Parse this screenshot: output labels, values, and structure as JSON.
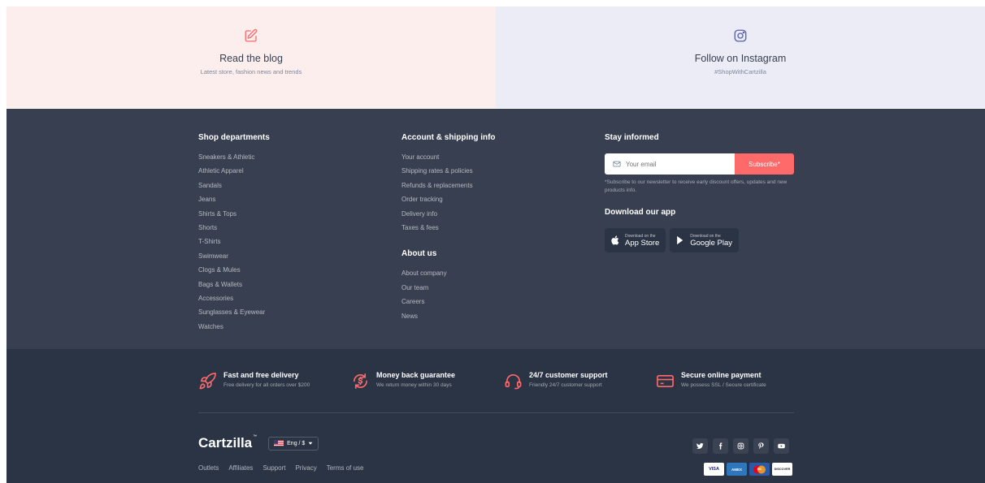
{
  "promo": {
    "blog": {
      "icon": "edit-icon",
      "title": "Read the blog",
      "subtitle": "Latest store, fashion news and trends"
    },
    "instagram": {
      "icon": "instagram-icon",
      "title": "Follow on Instagram",
      "subtitle": "#ShopWithCartzilla"
    }
  },
  "footer": {
    "departments": {
      "title": "Shop departments",
      "links": [
        "Sneakers & Athletic",
        "Athletic Apparel",
        "Sandals",
        "Jeans",
        "Shirts & Tops",
        "Shorts",
        "T-Shirts",
        "Swimwear",
        "Clogs & Mules",
        "Bags & Wallets",
        "Accessories",
        "Sunglasses & Eyewear",
        "Watches"
      ]
    },
    "account": {
      "title": "Account & shipping info",
      "links": [
        "Your account",
        "Shipping rates & policies",
        "Refunds & replacements",
        "Order tracking",
        "Delivery info",
        "Taxes & fees"
      ]
    },
    "about": {
      "title": "About us",
      "links": [
        "About company",
        "Our team",
        "Careers",
        "News"
      ]
    },
    "newsletter": {
      "title": "Stay informed",
      "placeholder": "Your email",
      "button": "Subscribe*",
      "note": "*Subscribe to our newsletter to receive early discount offers, updates and new products info."
    },
    "app": {
      "title": "Download our app",
      "appstore": {
        "small": "Download on the",
        "big": "App Store"
      },
      "googleplay": {
        "small": "Download on the",
        "big": "Google Play"
      }
    }
  },
  "features": [
    {
      "icon": "rocket-icon",
      "title": "Fast and free delivery",
      "subtitle": "Free delivery for all orders over $200"
    },
    {
      "icon": "money-back-icon",
      "title": "Money back guarantee",
      "subtitle": "We return money within 30 days"
    },
    {
      "icon": "headset-icon",
      "title": "24/7 customer support",
      "subtitle": "Friendly 24/7 customer support"
    },
    {
      "icon": "credit-card-icon",
      "title": "Secure online payment",
      "subtitle": "We possess SSL / Secure certificate"
    }
  ],
  "bottom": {
    "logo": "Cartzilla",
    "tm": "™",
    "lang": "Eng / $",
    "links": [
      "Outlets",
      "Affiliates",
      "Support",
      "Privacy",
      "Terms of use"
    ],
    "social": [
      "twitter-icon",
      "facebook-icon",
      "instagram-icon",
      "pinterest-icon",
      "youtube-icon"
    ],
    "cards": [
      "VISA",
      "AMEX",
      "MC",
      "DISCOVER"
    ]
  },
  "colors": {
    "accent": "#fe696a",
    "footer_bg": "#373f50",
    "footer_dark": "#2b3445"
  }
}
